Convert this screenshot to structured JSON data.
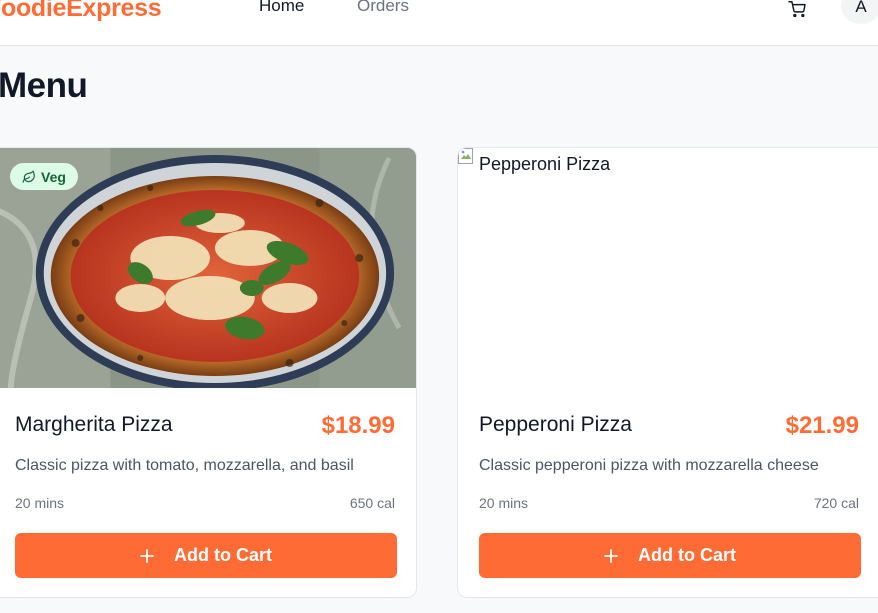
{
  "header": {
    "brand": "FoodieExpress",
    "nav": [
      {
        "label": "Home"
      },
      {
        "label": "Orders"
      }
    ],
    "cart_icon": "shopping-cart-icon",
    "avatar_initial": "A"
  },
  "page": {
    "title": "Menu"
  },
  "menu_items": [
    {
      "name": "Margherita Pizza",
      "price": "$18.99",
      "description": "Classic pizza with tomato, mozzarella, and basil",
      "time": "20 mins",
      "calories": "650 cal",
      "badge": "Veg",
      "badge_icon": "leaf-icon",
      "button_label": "Add to Cart",
      "button_icon": "plus-icon"
    },
    {
      "name": "Pepperoni Pizza",
      "image_alt": "Pepperoni Pizza",
      "price": "$21.99",
      "description": "Classic pepperoni pizza with mozzarella cheese",
      "time": "20 mins",
      "calories": "720 cal",
      "button_label": "Add to Cart",
      "button_icon": "plus-icon"
    }
  ],
  "colors": {
    "accent": "#ff6b35",
    "veg_badge_bg": "#dcfce7",
    "veg_badge_text": "#166534",
    "page_bg": "#f8f9fb"
  }
}
